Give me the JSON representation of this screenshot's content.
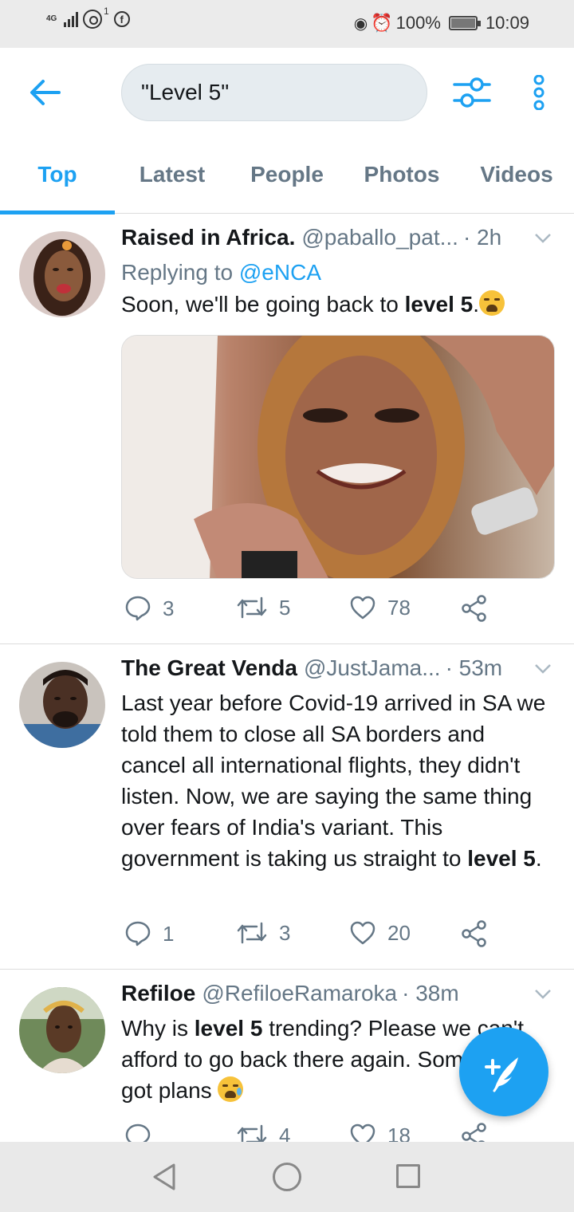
{
  "status_bar": {
    "network": "4G",
    "notification_count": "1",
    "battery": "100%",
    "time": "10:09"
  },
  "header": {
    "search_query": "\"Level 5\""
  },
  "tabs": [
    {
      "label": "Top",
      "active": true
    },
    {
      "label": "Latest",
      "active": false
    },
    {
      "label": "People",
      "active": false
    },
    {
      "label": "Photos",
      "active": false
    },
    {
      "label": "Videos",
      "active": false
    }
  ],
  "tweets": [
    {
      "name": "Raised in Africa.",
      "handle": "@paballo_pat...",
      "time": "· 2h",
      "replying_label": "Replying to",
      "replying_to": "@eNCA",
      "text_before": "Soon, we'll be going back to ",
      "text_bold": "level 5",
      "text_after": ".",
      "has_image": true,
      "replies": "3",
      "retweets": "5",
      "likes": "78"
    },
    {
      "name": "The Great Venda",
      "handle": "@JustJama...",
      "time": "· 53m",
      "text_before": "Last year before Covid-19 arrived in SA we told them to close all SA borders and cancel all international flights, they didn't listen. Now, we are saying the same thing over fears of India's variant. This government is taking us straight to ",
      "text_bold": "level 5",
      "text_after": ".",
      "replies": "1",
      "retweets": "3",
      "likes": "20"
    },
    {
      "name": "Refiloe",
      "handle": "@RefiloeRamaroka",
      "time": "· 38m",
      "text_before": "Why is ",
      "text_bold": "level 5",
      "text_after": " trending? Please we can't afford to go back there again. Some of us got plans ",
      "replies": "",
      "retweets": "4",
      "likes": "18"
    }
  ],
  "colors": {
    "accent": "#1da1f2",
    "secondary_text": "#657786",
    "divider": "#dcdcdc"
  },
  "icons": {
    "back": "arrow-left-icon",
    "filter": "sliders-icon",
    "more": "vertical-dots-icon",
    "compose": "feather-plus-icon",
    "reply": "speech-bubble-icon",
    "retweet": "retweet-icon",
    "like": "heart-icon",
    "share": "share-nodes-icon"
  }
}
